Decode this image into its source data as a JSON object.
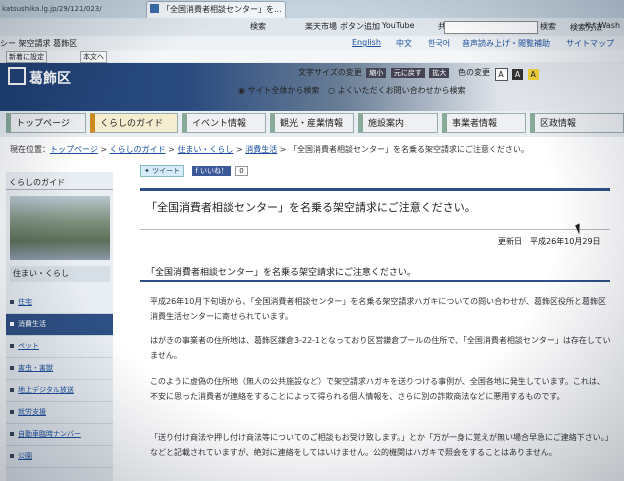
{
  "browser": {
    "url": "katsushika.lg.jp/29/121/023/",
    "tab_title": "「全国消費者相談センター」を..."
  },
  "toolbar": {
    "search_label": "検索",
    "rakuten": "楽天市場",
    "button_add": "ボタン追加",
    "youtube": "YouTube",
    "share": "共有",
    "highlight": "詳細",
    "user": "K.t Wash"
  },
  "bookmarks": {
    "left": "シー 架空請求  葛飾区",
    "english": "English",
    "chinese": "中文",
    "korean": "한국어",
    "detail": "詳細",
    "voice": "音声読み上げ・閲覧補助",
    "sitemap": "サイトマップ"
  },
  "bar3": {
    "btn1": "新着に設定",
    "btn2": "本文へ"
  },
  "header": {
    "site_name": "葛飾区",
    "fontsize_label": "文字サイズの変更",
    "font_smaller": "縮小",
    "font_reset": "元に戻す",
    "font_larger": "拡大",
    "color_label": "色の変更",
    "color_a1": "A",
    "color_a2": "A",
    "color_a3": "A",
    "search_opt1": "サイト全体から検索",
    "search_opt2": "よくいただくお問い合わせから検索",
    "search_button": "検索",
    "search_how": "検索方法"
  },
  "nav": [
    "トップページ",
    "くらしのガイド",
    "イベント情報",
    "観光・産業情報",
    "施設案内",
    "事業者情報",
    "区政情報"
  ],
  "breadcrumb": {
    "prefix": "現在位置：",
    "items": [
      "トップページ",
      "くらしのガイド",
      "住まい・くらし",
      "消費生活"
    ],
    "current": "「全国消費者相談センター」を名乗る架空請求にご注意ください。"
  },
  "sidebar": {
    "title": "くらしのガイド",
    "subtitle": "住まい・くらし",
    "items": [
      "住宅",
      "消費生活",
      "ペット",
      "害虫・害獣",
      "地上デジタル放送",
      "就労支援",
      "自動車臨時ナンバー",
      "公園"
    ]
  },
  "share": {
    "tweet": "ツイート",
    "like": "いいね！",
    "count": "0"
  },
  "article": {
    "title": "「全国消費者相談センター」を名乗る架空請求にご注意ください。",
    "updated": "更新日　平成26年10月29日",
    "subtitle": "「全国消費者相談センター」を名乗る架空請求にご注意ください。",
    "p1": "平成26年10月下旬頃から、「全国消費者相談センター」を名乗る架空請求ハガキについての問い合わせが、葛飾区役所と葛飾区消費生活センターに寄せられています。",
    "p2": "はがきの事業者の住所地は、葛飾区鎌倉3-22-1となっており区営鎌倉プールの住所で、「全国消費者相談センター」は存在していません。",
    "p3": "このように虚偽の住所地（無人の公共施設など）で架空請求ハガキを送りつける事例が、全国各地に発生しています。これは、不安に思った消費者が連絡をすることによって得られる個人情報を、さらに別の詐欺商法などに悪用するものです。",
    "p4": "「送り付け商法や押し付け商法等についてのご相談もお受け致します。」とか「万が一身に覚えが無い場合早急にご連絡下さい。」などと記載されていますが、絶対に連絡をしてはいけません。公的機関はハガキで照会をすることはありません。"
  }
}
